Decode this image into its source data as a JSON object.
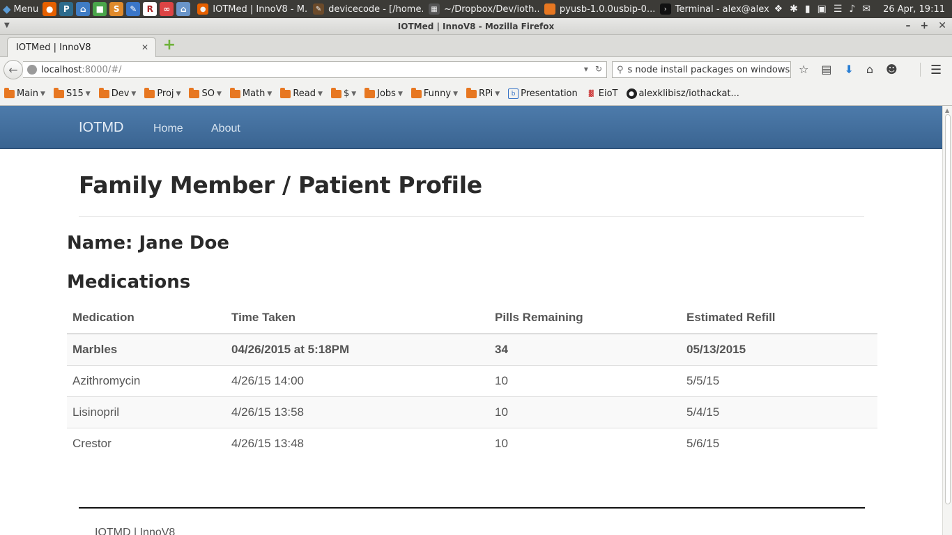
{
  "system_panel": {
    "menu_label": "Menu",
    "tasks": [
      {
        "label": "IOTMed | InnoV8 - M...",
        "icon": "firefox-icon"
      },
      {
        "label": "devicecode - [/home...",
        "icon": "editor-icon"
      },
      {
        "label": "~/Dropbox/Dev/ioth...",
        "icon": "terminal-icon"
      },
      {
        "label": "pyusb-1.0.0usbip-0....",
        "icon": "folder-icon"
      },
      {
        "label": "Terminal - alex@alex...",
        "icon": "terminal-icon"
      }
    ],
    "clock": "26 Apr, 19:11"
  },
  "window": {
    "title": "IOTMed | InnoV8 - Mozilla Firefox"
  },
  "tab": {
    "title": "IOTMed | InnoV8"
  },
  "nav": {
    "url_host": "localhost",
    "url_rest": ":8000/#/",
    "search_value": "s node install packages on windows"
  },
  "bookmarks": [
    {
      "label": "Main",
      "type": "folder"
    },
    {
      "label": "S15",
      "type": "folder"
    },
    {
      "label": "Dev",
      "type": "folder"
    },
    {
      "label": "Proj",
      "type": "folder"
    },
    {
      "label": "SO",
      "type": "folder"
    },
    {
      "label": "Math",
      "type": "folder"
    },
    {
      "label": "Read",
      "type": "folder"
    },
    {
      "label": "$",
      "type": "folder"
    },
    {
      "label": "Jobs",
      "type": "folder"
    },
    {
      "label": "Funny",
      "type": "folder"
    },
    {
      "label": "RPi",
      "type": "folder"
    },
    {
      "label": "Presentation",
      "type": "link"
    },
    {
      "label": "EioT",
      "type": "link"
    },
    {
      "label": "alexklibisz/iothackat...",
      "type": "link"
    }
  ],
  "site": {
    "brand": "IOTMD",
    "nav_links": [
      "Home",
      "About"
    ],
    "page_title": "Family Member / Patient Profile",
    "name_heading": "Name: Jane Doe",
    "medications_heading": "Medications",
    "table": {
      "headers": [
        "Medication",
        "Time Taken",
        "Pills Remaining",
        "Estimated Refill"
      ],
      "rows": [
        [
          "Marbles",
          "04/26/2015 at 5:18PM",
          "34",
          "05/13/2015"
        ],
        [
          "Azithromycin",
          "4/26/15 14:00",
          "10",
          "5/5/15"
        ],
        [
          "Lisinopril",
          "4/26/15 13:58",
          "10",
          "5/4/15"
        ],
        [
          "Crestor",
          "4/26/15 13:48",
          "10",
          "5/6/15"
        ]
      ]
    },
    "footer": "IOTMD | InnoV8"
  },
  "colors": {
    "navbar": "#3f6b99",
    "panel": "#3c3b37",
    "folder": "#e77721"
  }
}
